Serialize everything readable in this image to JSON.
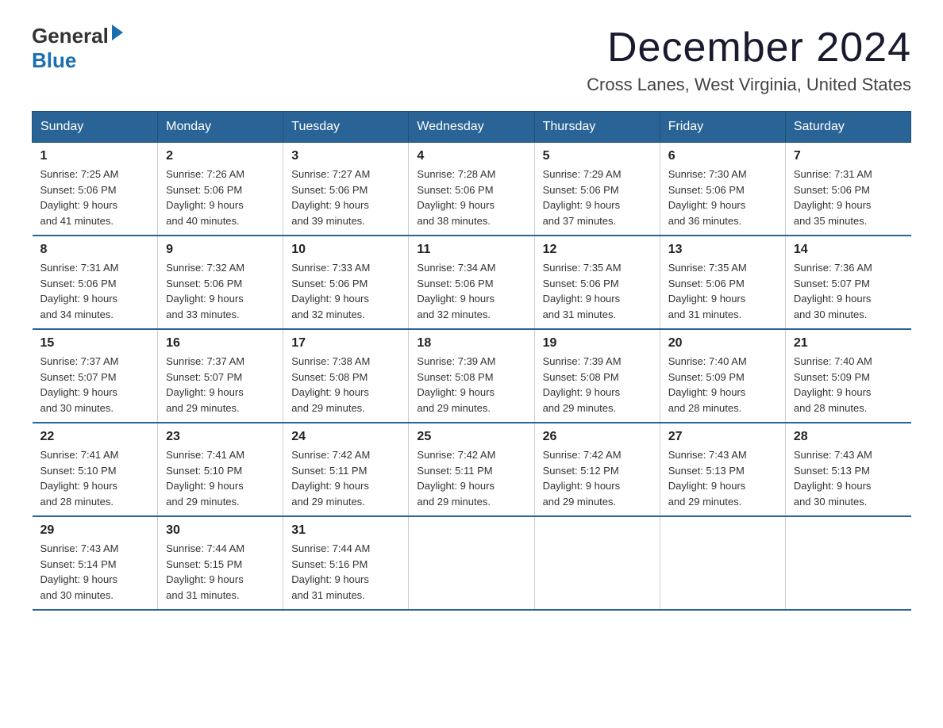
{
  "logo": {
    "general": "General",
    "blue": "Blue"
  },
  "title": "December 2024",
  "subtitle": "Cross Lanes, West Virginia, United States",
  "days_of_week": [
    "Sunday",
    "Monday",
    "Tuesday",
    "Wednesday",
    "Thursday",
    "Friday",
    "Saturday"
  ],
  "weeks": [
    [
      {
        "day": "1",
        "sunrise": "7:25 AM",
        "sunset": "5:06 PM",
        "daylight": "9 hours and 41 minutes."
      },
      {
        "day": "2",
        "sunrise": "7:26 AM",
        "sunset": "5:06 PM",
        "daylight": "9 hours and 40 minutes."
      },
      {
        "day": "3",
        "sunrise": "7:27 AM",
        "sunset": "5:06 PM",
        "daylight": "9 hours and 39 minutes."
      },
      {
        "day": "4",
        "sunrise": "7:28 AM",
        "sunset": "5:06 PM",
        "daylight": "9 hours and 38 minutes."
      },
      {
        "day": "5",
        "sunrise": "7:29 AM",
        "sunset": "5:06 PM",
        "daylight": "9 hours and 37 minutes."
      },
      {
        "day": "6",
        "sunrise": "7:30 AM",
        "sunset": "5:06 PM",
        "daylight": "9 hours and 36 minutes."
      },
      {
        "day": "7",
        "sunrise": "7:31 AM",
        "sunset": "5:06 PM",
        "daylight": "9 hours and 35 minutes."
      }
    ],
    [
      {
        "day": "8",
        "sunrise": "7:31 AM",
        "sunset": "5:06 PM",
        "daylight": "9 hours and 34 minutes."
      },
      {
        "day": "9",
        "sunrise": "7:32 AM",
        "sunset": "5:06 PM",
        "daylight": "9 hours and 33 minutes."
      },
      {
        "day": "10",
        "sunrise": "7:33 AM",
        "sunset": "5:06 PM",
        "daylight": "9 hours and 32 minutes."
      },
      {
        "day": "11",
        "sunrise": "7:34 AM",
        "sunset": "5:06 PM",
        "daylight": "9 hours and 32 minutes."
      },
      {
        "day": "12",
        "sunrise": "7:35 AM",
        "sunset": "5:06 PM",
        "daylight": "9 hours and 31 minutes."
      },
      {
        "day": "13",
        "sunrise": "7:35 AM",
        "sunset": "5:06 PM",
        "daylight": "9 hours and 31 minutes."
      },
      {
        "day": "14",
        "sunrise": "7:36 AM",
        "sunset": "5:07 PM",
        "daylight": "9 hours and 30 minutes."
      }
    ],
    [
      {
        "day": "15",
        "sunrise": "7:37 AM",
        "sunset": "5:07 PM",
        "daylight": "9 hours and 30 minutes."
      },
      {
        "day": "16",
        "sunrise": "7:37 AM",
        "sunset": "5:07 PM",
        "daylight": "9 hours and 29 minutes."
      },
      {
        "day": "17",
        "sunrise": "7:38 AM",
        "sunset": "5:08 PM",
        "daylight": "9 hours and 29 minutes."
      },
      {
        "day": "18",
        "sunrise": "7:39 AM",
        "sunset": "5:08 PM",
        "daylight": "9 hours and 29 minutes."
      },
      {
        "day": "19",
        "sunrise": "7:39 AM",
        "sunset": "5:08 PM",
        "daylight": "9 hours and 29 minutes."
      },
      {
        "day": "20",
        "sunrise": "7:40 AM",
        "sunset": "5:09 PM",
        "daylight": "9 hours and 28 minutes."
      },
      {
        "day": "21",
        "sunrise": "7:40 AM",
        "sunset": "5:09 PM",
        "daylight": "9 hours and 28 minutes."
      }
    ],
    [
      {
        "day": "22",
        "sunrise": "7:41 AM",
        "sunset": "5:10 PM",
        "daylight": "9 hours and 28 minutes."
      },
      {
        "day": "23",
        "sunrise": "7:41 AM",
        "sunset": "5:10 PM",
        "daylight": "9 hours and 29 minutes."
      },
      {
        "day": "24",
        "sunrise": "7:42 AM",
        "sunset": "5:11 PM",
        "daylight": "9 hours and 29 minutes."
      },
      {
        "day": "25",
        "sunrise": "7:42 AM",
        "sunset": "5:11 PM",
        "daylight": "9 hours and 29 minutes."
      },
      {
        "day": "26",
        "sunrise": "7:42 AM",
        "sunset": "5:12 PM",
        "daylight": "9 hours and 29 minutes."
      },
      {
        "day": "27",
        "sunrise": "7:43 AM",
        "sunset": "5:13 PM",
        "daylight": "9 hours and 29 minutes."
      },
      {
        "day": "28",
        "sunrise": "7:43 AM",
        "sunset": "5:13 PM",
        "daylight": "9 hours and 30 minutes."
      }
    ],
    [
      {
        "day": "29",
        "sunrise": "7:43 AM",
        "sunset": "5:14 PM",
        "daylight": "9 hours and 30 minutes."
      },
      {
        "day": "30",
        "sunrise": "7:44 AM",
        "sunset": "5:15 PM",
        "daylight": "9 hours and 31 minutes."
      },
      {
        "day": "31",
        "sunrise": "7:44 AM",
        "sunset": "5:16 PM",
        "daylight": "9 hours and 31 minutes."
      },
      null,
      null,
      null,
      null
    ]
  ]
}
